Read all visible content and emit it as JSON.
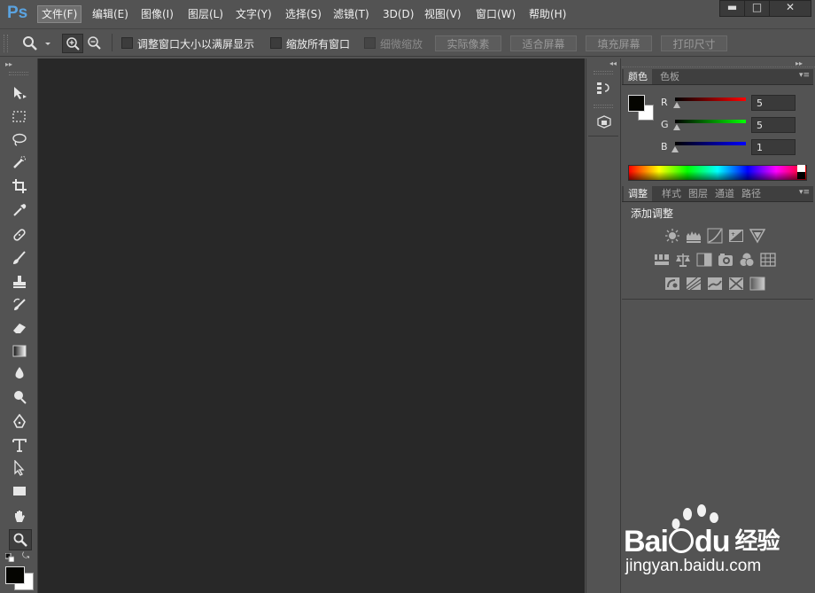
{
  "app": {
    "logo": "Ps"
  },
  "menu": [
    "文件(F)",
    "编辑(E)",
    "图像(I)",
    "图层(L)",
    "文字(Y)",
    "选择(S)",
    "滤镜(T)",
    "3D(D)",
    "视图(V)",
    "窗口(W)",
    "帮助(H)"
  ],
  "window_controls": {
    "minimize": "▬",
    "maximize": "□",
    "close": "✕"
  },
  "options": {
    "resize_windows": "调整窗口大小以满屏显示",
    "zoom_all": "缩放所有窗口",
    "scrubby_zoom": "细微缩放",
    "actual_pixels": "实际像素",
    "fit_screen": "适合屏幕",
    "fill_screen": "填充屏幕",
    "print_size": "打印尺寸"
  },
  "color_panel": {
    "tabs": [
      "颜色",
      "色板"
    ],
    "channels": [
      {
        "label": "R",
        "value": "5"
      },
      {
        "label": "G",
        "value": "5"
      },
      {
        "label": "B",
        "value": "1"
      }
    ]
  },
  "adjust_panel": {
    "tabs": [
      "调整",
      "样式",
      "图层",
      "通道",
      "路径"
    ],
    "heading": "添加调整"
  },
  "watermark": {
    "brand_left": "Bai",
    "brand_right": "du",
    "brand_cn": "经验",
    "url": "jingyan.baidu.com"
  },
  "colors": {
    "accent": "#5aa3e0",
    "canvas": "#282828",
    "chrome": "#535353"
  }
}
